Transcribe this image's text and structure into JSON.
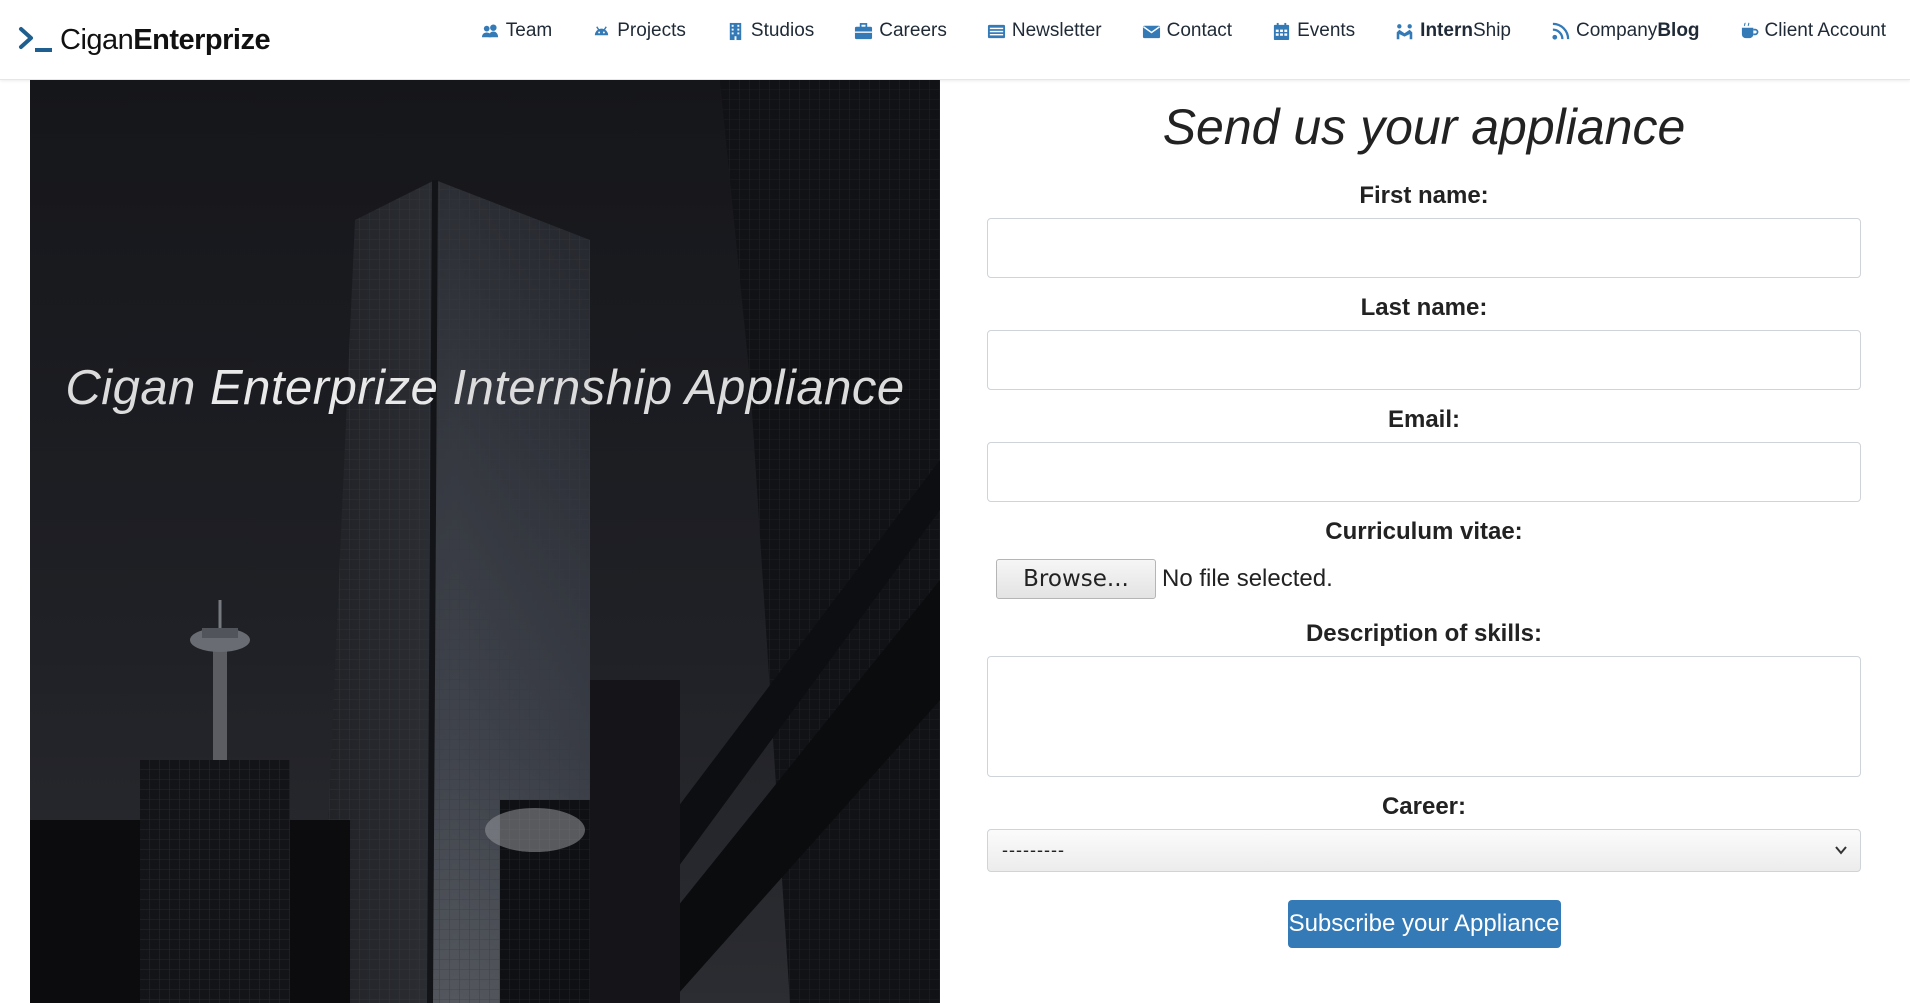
{
  "brand": {
    "prefix": "Cigan",
    "suffix": "Enterprize"
  },
  "colors": {
    "nav_icon": "#337ab7",
    "brand_mark": "#1f5f8f",
    "submit_bg": "#337ab7"
  },
  "nav": {
    "items": [
      {
        "label": "Team",
        "icon": "users-icon"
      },
      {
        "label": "Projects",
        "icon": "android-icon"
      },
      {
        "label": "Studios",
        "icon": "building-icon"
      },
      {
        "label": "Careers",
        "icon": "briefcase-icon"
      },
      {
        "label": "Newsletter",
        "icon": "newspaper-icon"
      },
      {
        "label": "Contact",
        "icon": "envelope-icon"
      },
      {
        "label": "Events",
        "icon": "calendar-icon"
      },
      {
        "label_a": "Intern",
        "label_b": "Ship",
        "icon": "handshake-icon"
      },
      {
        "label_a": "Company",
        "label_b": "Blog",
        "icon": "rss-icon"
      },
      {
        "label": "Client Account",
        "icon": "coffee-icon"
      }
    ]
  },
  "hero": {
    "title_a": "Cigan ",
    "title_b": "Enterprize",
    "title_c": " Internship Appliance"
  },
  "form": {
    "title": "Send us your appliance",
    "first_name_label": "First name:",
    "last_name_label": "Last name:",
    "email_label": "Email:",
    "cv_label": "Curriculum vitae:",
    "browse_label": "Browse...",
    "file_status": "No file selected.",
    "skills_label": "Description of skills:",
    "career_label": "Career:",
    "career_selected": "---------",
    "submit_label": "Subscribe your Appliance"
  }
}
